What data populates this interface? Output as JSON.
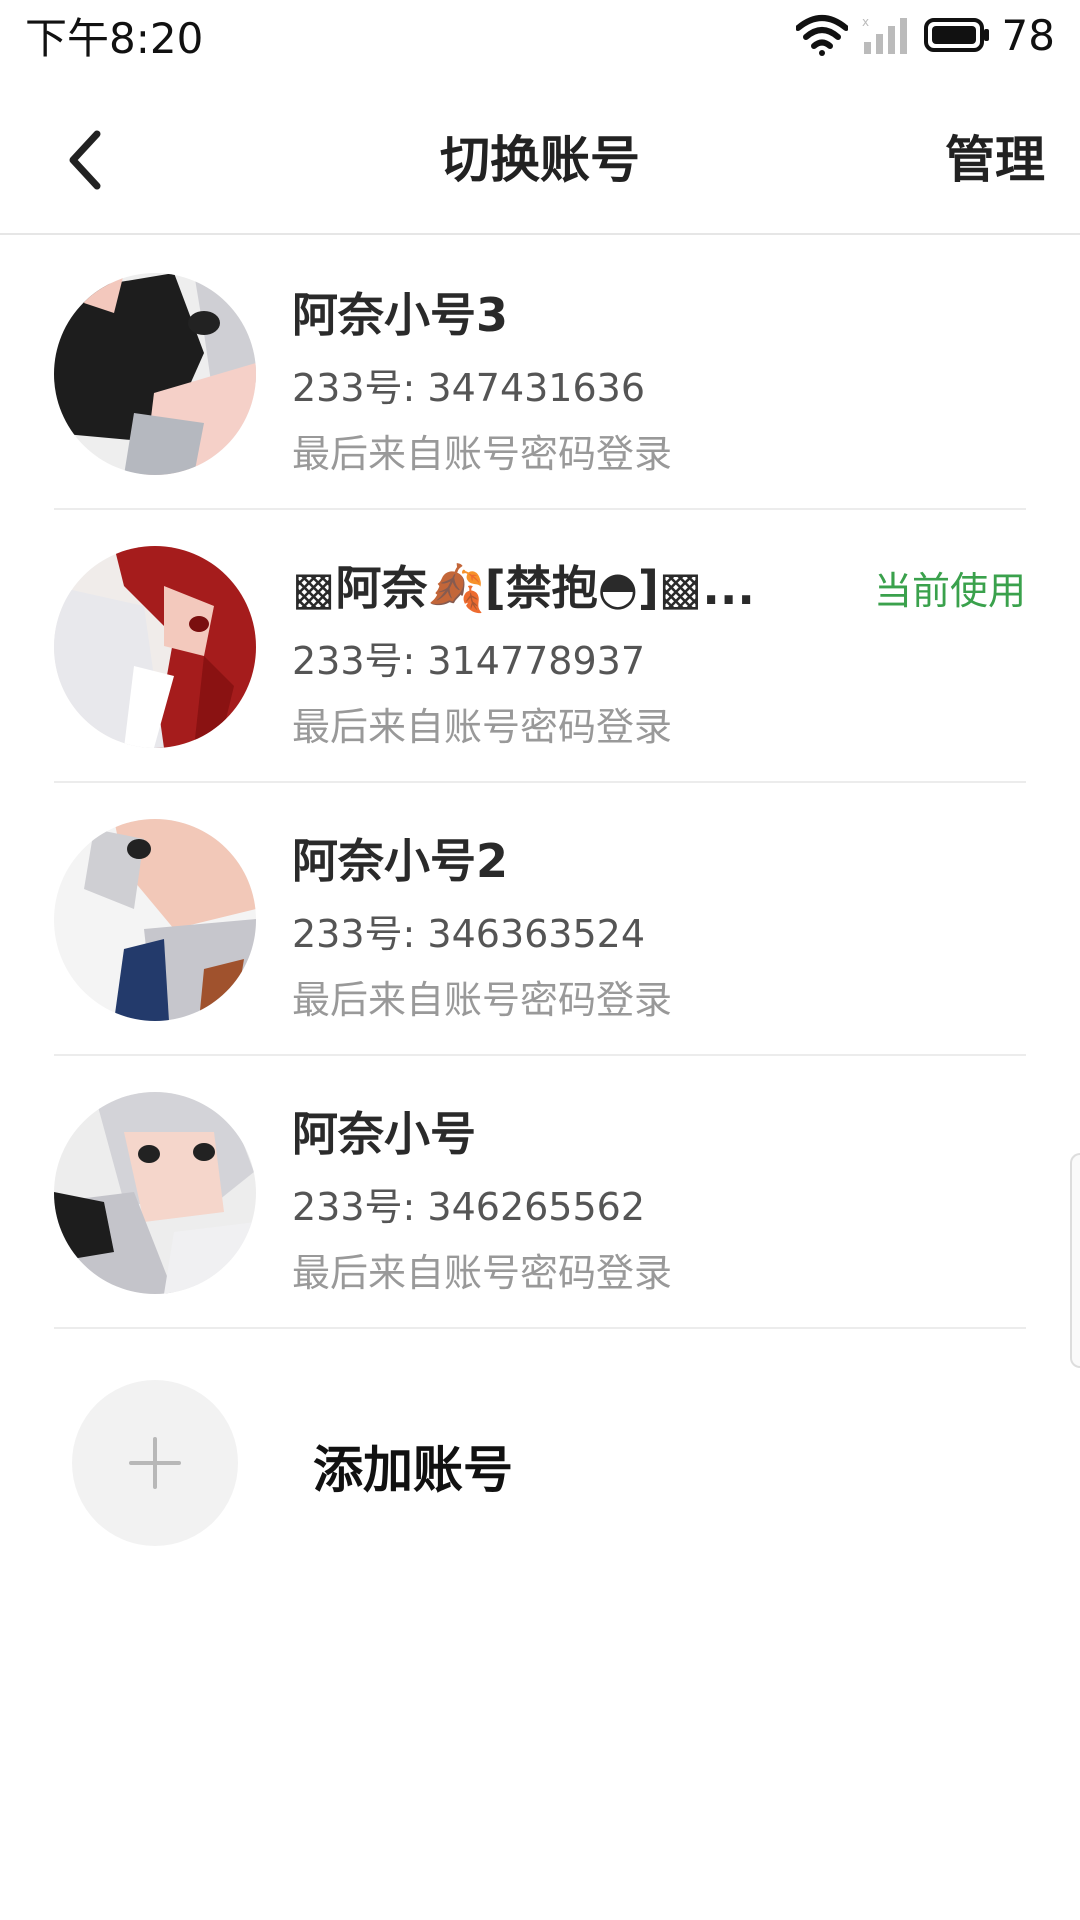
{
  "status": {
    "time": "下午8:20",
    "battery": "78"
  },
  "nav": {
    "title": "切换账号",
    "manage": "管理"
  },
  "accounts": [
    {
      "name": "阿奈小号3",
      "id": "233号: 347431636",
      "login": "最后来自账号密码登录",
      "current": ""
    },
    {
      "name": "▩阿奈🍂[禁抱◓]▩...",
      "id": "233号: 314778937",
      "login": "最后来自账号密码登录",
      "current": "当前使用"
    },
    {
      "name": "阿奈小号2",
      "id": "233号: 346363524",
      "login": "最后来自账号密码登录",
      "current": ""
    },
    {
      "name": "阿奈小号",
      "id": "233号: 346265562",
      "login": "最后来自账号密码登录",
      "current": ""
    }
  ],
  "add_account": {
    "label": "添加账号",
    "icon": "plus-icon"
  },
  "colors": {
    "accent_green": "#3aa14c",
    "divider": "#ececec",
    "secondary_text": "#999999"
  }
}
